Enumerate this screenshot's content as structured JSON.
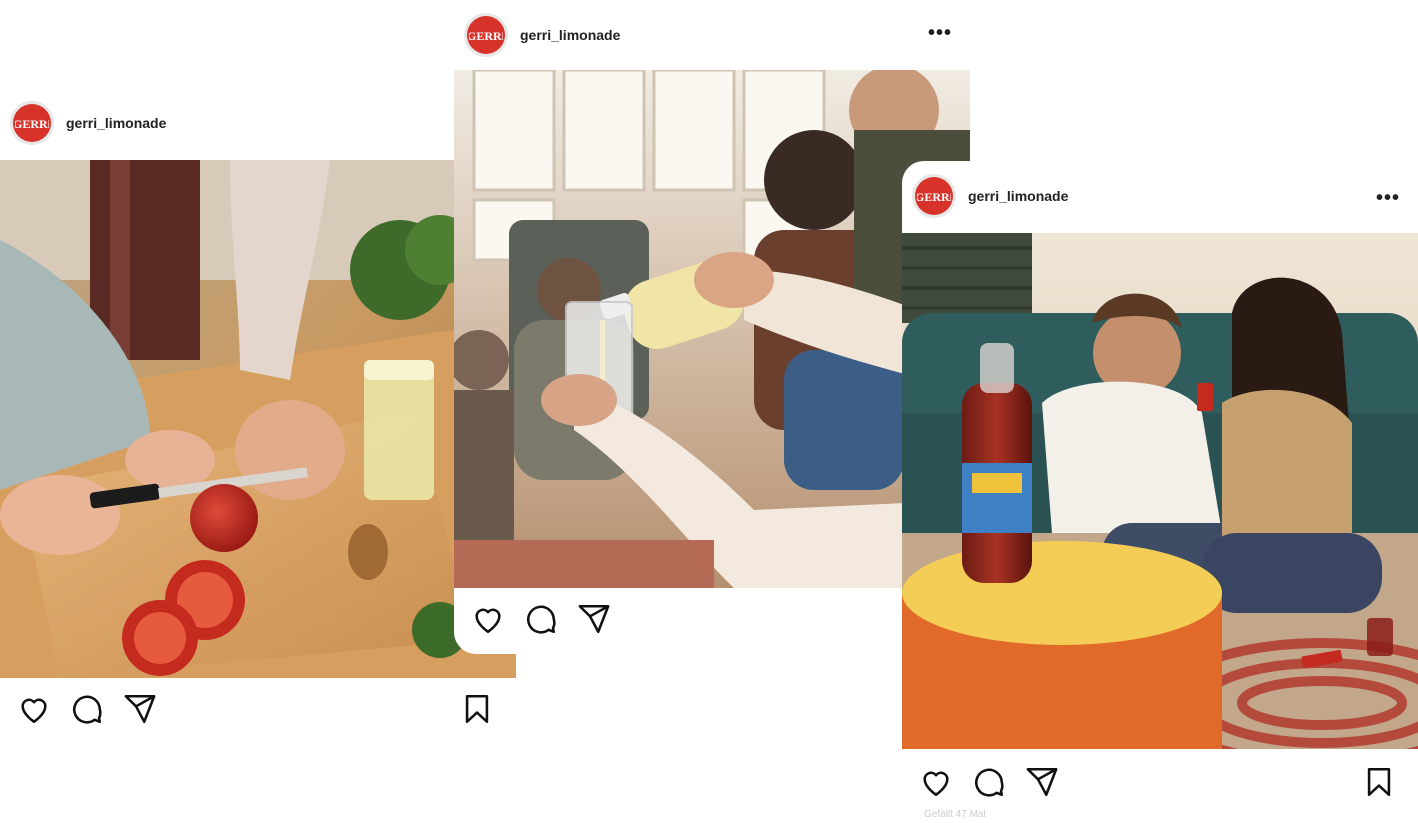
{
  "posts": [
    {
      "username": "gerri_limonade",
      "image_alt": "Hands slicing a tomato on a wooden cutting board next to a glass of lemonade",
      "caption_fragment": ""
    },
    {
      "username": "gerri_limonade",
      "more_label": "•••",
      "image_alt": "Lemonade being poured into a glass among friends in a sunlit room"
    },
    {
      "username": "gerri_limonade",
      "more_label": "•••",
      "image_alt": "Couple laughing while playing cards on the floor, bottle of Gerri on a yellow table",
      "caption_fragment": "Gefällt 47 Mal"
    }
  ],
  "icons": [
    "heart-icon",
    "comment-icon",
    "send-icon",
    "bookmark-icon"
  ],
  "colors": {
    "brand_red": "#d8332b",
    "text": "#111111"
  }
}
